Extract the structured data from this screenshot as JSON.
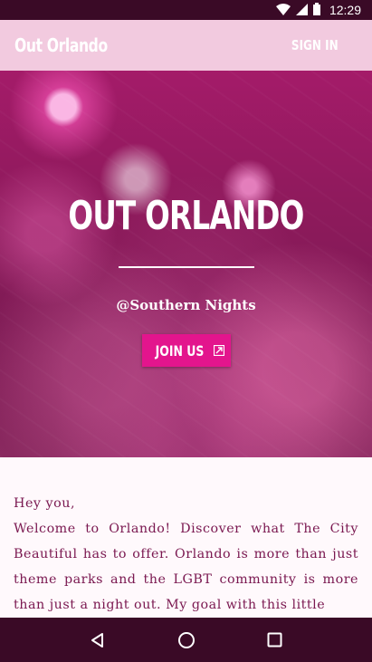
{
  "status_bar": {
    "time": "12:29",
    "icons": [
      "wifi-icon",
      "signal-icon",
      "battery-icon"
    ]
  },
  "app_bar": {
    "brand": "Out Orlando",
    "sign_in": "SIGN IN"
  },
  "hero": {
    "title": "OUT ORLANDO",
    "subtitle": "@Southern Nights",
    "join_label": "JOIN US",
    "join_icon": "external-link-icon"
  },
  "content": {
    "greeting": "Hey you,",
    "body": "Welcome to Orlando! Discover what The City Beautiful has to offer. Orlando is more than just theme parks and the LGBT community is more than just a night out. My goal with this little"
  },
  "nav_bar": {
    "buttons": [
      "back-icon",
      "home-icon",
      "recents-icon"
    ]
  },
  "colors": {
    "status_bar": "#3a0a26",
    "app_bar": "#f2cadf",
    "accent": "#e3158d",
    "text": "#7a1850"
  }
}
